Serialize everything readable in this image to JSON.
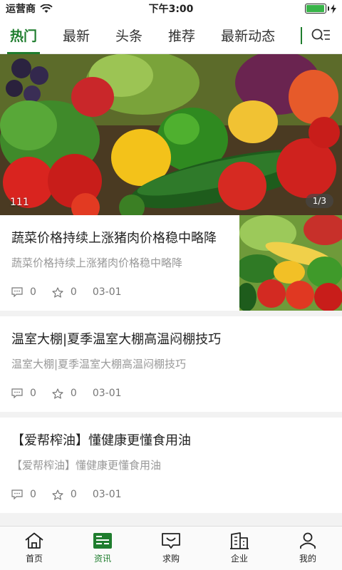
{
  "status_bar": {
    "carrier": "运营商",
    "time": "下午3:00",
    "battery_level": 0.95
  },
  "tabs": [
    {
      "label": "热门",
      "active": true
    },
    {
      "label": "最新",
      "active": false
    },
    {
      "label": "头条",
      "active": false
    },
    {
      "label": "推荐",
      "active": false
    },
    {
      "label": "最新动态",
      "active": false
    }
  ],
  "banner": {
    "caption": "111",
    "pager": "1/3"
  },
  "news": [
    {
      "title": "蔬菜价格持续上涨猪肉价格稳中略降",
      "summary": "蔬菜价格持续上涨猪肉价格稳中略降",
      "comments": "0",
      "likes": "0",
      "date": "03-01"
    },
    {
      "title": "温室大棚|夏季温室大棚高温闷棚技巧",
      "summary": "温室大棚|夏季温室大棚高温闷棚技巧",
      "comments": "0",
      "likes": "0",
      "date": "03-01"
    },
    {
      "title": "【爱帮榨油】懂健康更懂食用油",
      "summary": "【爱帮榨油】懂健康更懂食用油",
      "comments": "0",
      "likes": "0",
      "date": "03-01"
    }
  ],
  "bottom_nav": [
    {
      "label": "首页",
      "icon": "home-icon",
      "active": false
    },
    {
      "label": "资讯",
      "icon": "news-icon",
      "active": true
    },
    {
      "label": "求购",
      "icon": "purchase-icon",
      "active": false
    },
    {
      "label": "企业",
      "icon": "company-icon",
      "active": false
    },
    {
      "label": "我的",
      "icon": "profile-icon",
      "active": false
    }
  ],
  "colors": {
    "accent": "#1f7d2e",
    "battery": "#38b449"
  }
}
